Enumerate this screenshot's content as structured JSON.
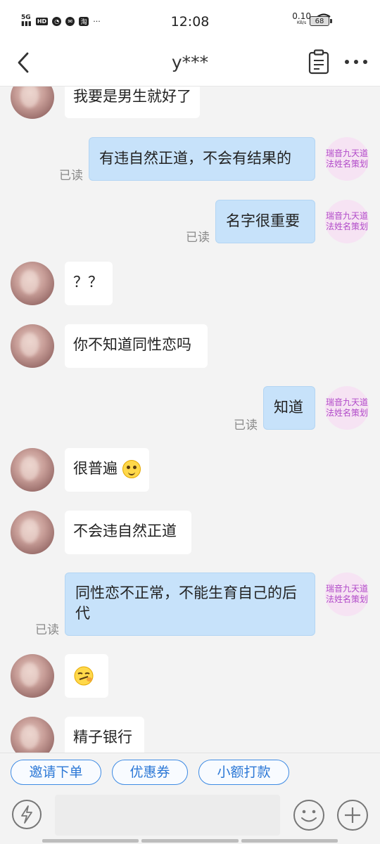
{
  "status_bar": {
    "network": "5G",
    "hd": "HD",
    "time": "12:08",
    "speed_value": "0.10",
    "speed_unit": "KB/s",
    "battery": "68",
    "taobao_icon": "淘",
    "ellipsis": "···"
  },
  "header": {
    "title": "y***"
  },
  "seller_avatar_label": "瑞音九天道法姓名策划",
  "read_label": "已读",
  "messages": [
    {
      "side": "left",
      "text": "我要是男生就好了"
    },
    {
      "side": "right",
      "text": "有违自然正道，不会有结果的"
    },
    {
      "side": "right",
      "text": "名字很重要"
    },
    {
      "side": "left",
      "text": "？？"
    },
    {
      "side": "left",
      "text": "你不知道同性恋吗"
    },
    {
      "side": "right",
      "text": "知道"
    },
    {
      "side": "left",
      "text": "很普遍"
    },
    {
      "side": "left",
      "text": "不会违自然正道"
    },
    {
      "side": "right",
      "text": "同性恋不正常，不能生育自己的后代"
    },
    {
      "side": "left",
      "text": "",
      "emoji": "sleepy-face-emoji"
    },
    {
      "side": "left",
      "text": "精子银行"
    }
  ],
  "quick_actions": [
    "邀请下单",
    "优惠券",
    "小额打款"
  ],
  "input": {
    "placeholder": ""
  },
  "colors": {
    "accent": "#2c78d6",
    "sent_bubble": "#c7e2fa",
    "seller_avatar_bg": "#f6e3f3",
    "seller_avatar_text": "#b14bc9"
  }
}
